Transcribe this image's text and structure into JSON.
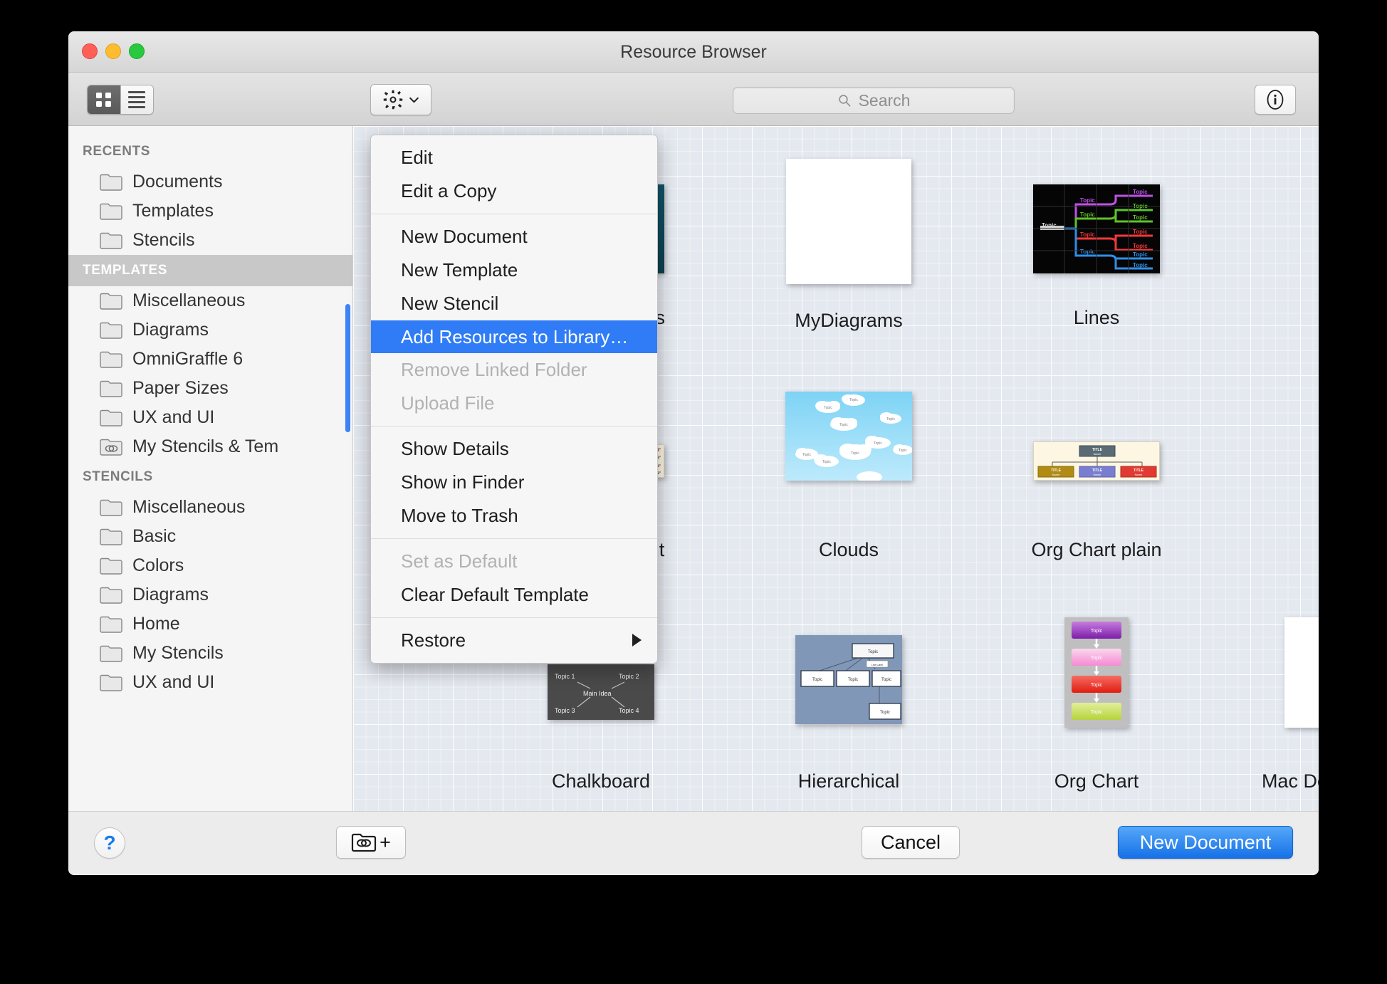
{
  "window": {
    "title": "Resource Browser",
    "traffic_lights": [
      "close",
      "minimize",
      "zoom"
    ]
  },
  "toolbar": {
    "view_grid_icon": "grid-view-icon",
    "view_list_icon": "list-view-icon",
    "gear_icon": "gear-icon",
    "gear_chevron_icon": "chevron-down-icon",
    "search": {
      "placeholder": "Search",
      "value": "",
      "icon": "search-icon"
    },
    "info_icon": "info-circle-icon"
  },
  "gear_menu": {
    "groups": [
      {
        "items": [
          {
            "label": "Edit",
            "state": "enabled"
          },
          {
            "label": "Edit a Copy",
            "state": "enabled"
          }
        ]
      },
      {
        "items": [
          {
            "label": "New Document",
            "state": "enabled"
          },
          {
            "label": "New Template",
            "state": "enabled"
          },
          {
            "label": "New Stencil",
            "state": "enabled"
          },
          {
            "label": "Add Resources to Library…",
            "state": "highlighted"
          },
          {
            "label": "Remove Linked Folder",
            "state": "disabled"
          },
          {
            "label": "Upload File",
            "state": "disabled"
          }
        ]
      },
      {
        "items": [
          {
            "label": "Show Details",
            "state": "enabled"
          },
          {
            "label": "Show in Finder",
            "state": "enabled"
          },
          {
            "label": "Move to Trash",
            "state": "enabled"
          }
        ]
      },
      {
        "items": [
          {
            "label": "Set as Default",
            "state": "disabled"
          },
          {
            "label": "Clear Default Template",
            "state": "enabled"
          }
        ]
      },
      {
        "items": [
          {
            "label": "Restore",
            "state": "enabled",
            "submenu": true
          }
        ]
      }
    ]
  },
  "sidebar": {
    "sections": [
      {
        "header": "RECENTS",
        "header_selected": false,
        "items": [
          {
            "label": "Documents",
            "icon": "folder-icon"
          },
          {
            "label": "Templates",
            "icon": "folder-icon"
          },
          {
            "label": "Stencils",
            "icon": "folder-icon"
          }
        ]
      },
      {
        "header": "TEMPLATES",
        "header_selected": true,
        "items": [
          {
            "label": "Miscellaneous",
            "icon": "folder-icon"
          },
          {
            "label": "Diagrams",
            "icon": "folder-icon"
          },
          {
            "label": "OmniGraffle 6",
            "icon": "folder-icon"
          },
          {
            "label": "Paper Sizes",
            "icon": "folder-icon"
          },
          {
            "label": "UX and UI",
            "icon": "folder-icon"
          },
          {
            "label": "My Stencils & Tem",
            "icon": "linked-folder-icon"
          }
        ]
      },
      {
        "header": "STENCILS",
        "header_selected": false,
        "items": [
          {
            "label": "Miscellaneous",
            "icon": "folder-icon"
          },
          {
            "label": "Basic",
            "icon": "folder-icon"
          },
          {
            "label": "Colors",
            "icon": "folder-icon"
          },
          {
            "label": "Diagrams",
            "icon": "folder-icon"
          },
          {
            "label": "Home",
            "icon": "folder-icon"
          },
          {
            "label": "My Stencils",
            "icon": "folder-icon"
          },
          {
            "label": "UX and UI",
            "icon": "folder-icon"
          }
        ]
      }
    ]
  },
  "content": {
    "tiles": [
      {
        "label": "MasterBlasters",
        "thumb": "masterblasters"
      },
      {
        "label": "MyDiagrams",
        "thumb": "mydiagrams"
      },
      {
        "label": "Lines",
        "thumb": "lines"
      },
      {
        "label": "Solarized Light",
        "thumb": "solarized"
      },
      {
        "label": "Clouds",
        "thumb": "clouds"
      },
      {
        "label": "Org Chart plain",
        "thumb": "orgplain"
      },
      {
        "label": "Chalkboard",
        "thumb": "chalkboard"
      },
      {
        "label": "Hierarchical",
        "thumb": "hierarchical"
      },
      {
        "label": "Org Chart",
        "thumb": "orgchart"
      },
      {
        "label": "Mac Document Icon",
        "thumb": "macdoc"
      }
    ],
    "thumb_text": {
      "topic": "Topic",
      "title": "TITLE",
      "name": "Name",
      "line_label": "Line Label",
      "chalk": [
        "Topic 1",
        "Topic 2",
        "Main Idea",
        "Topic 3",
        "Topic 4"
      ]
    }
  },
  "bottom_bar": {
    "help_label": "?",
    "add_linked_folder_icon": "linked-folder-plus-icon",
    "add_linked_folder_plus": "+",
    "cancel_label": "Cancel",
    "new_document_label": "New Document"
  },
  "colors": {
    "accent_blue": "#2f7cf6",
    "primary_button": "#1671e8",
    "sidebar_selected": "#c8c8c8",
    "canvas": "#e4e9f0"
  }
}
